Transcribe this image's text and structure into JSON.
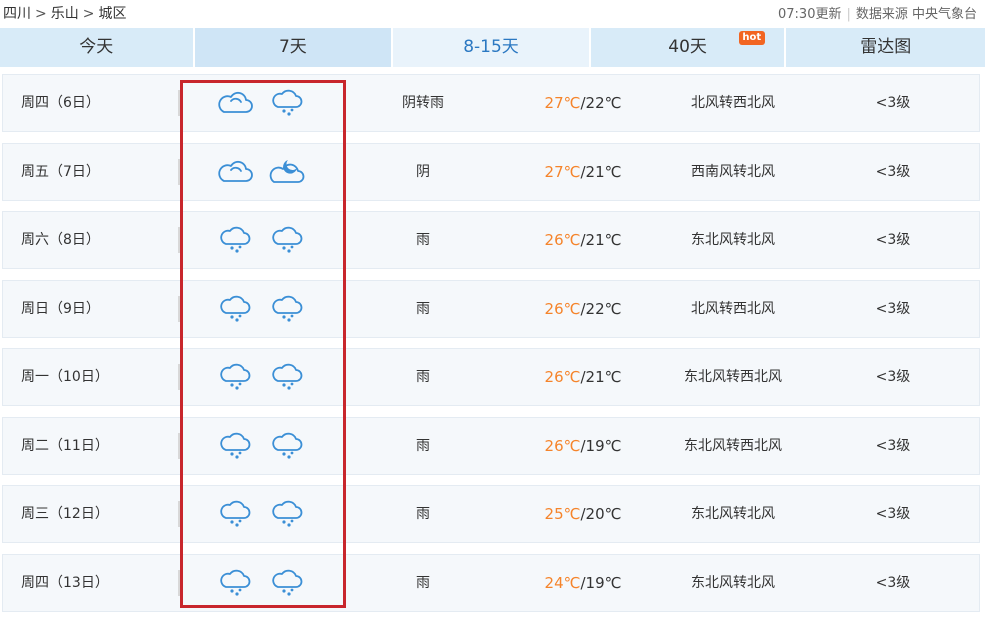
{
  "breadcrumb": {
    "province": "四川",
    "city": "乐山",
    "district": "城区",
    "sep": ">"
  },
  "meta": {
    "updated": "07:30更新",
    "source": "数据来源 中央气象台"
  },
  "tabs": [
    {
      "label": "今天"
    },
    {
      "label": "7天"
    },
    {
      "label": "8-15天"
    },
    {
      "label": "40天"
    },
    {
      "label": "雷达图"
    }
  ],
  "hot_badge": "hot",
  "forecast": [
    {
      "day": "周四（6日）",
      "icon_day": "cloudy-icon",
      "icon_night": "rain-icon",
      "desc": "阴转雨",
      "high": "27℃",
      "low": "/22℃",
      "wind": "北风转西北风",
      "level": "<3级"
    },
    {
      "day": "周五（7日）",
      "icon_day": "cloudy-icon",
      "icon_night": "cloudy-night-icon",
      "desc": "阴",
      "high": "27℃",
      "low": "/21℃",
      "wind": "西南风转北风",
      "level": "<3级"
    },
    {
      "day": "周六（8日）",
      "icon_day": "rain-icon",
      "icon_night": "rain-icon",
      "desc": "雨",
      "high": "26℃",
      "low": "/21℃",
      "wind": "东北风转北风",
      "level": "<3级"
    },
    {
      "day": "周日（9日）",
      "icon_day": "rain-icon",
      "icon_night": "rain-icon",
      "desc": "雨",
      "high": "26℃",
      "low": "/22℃",
      "wind": "北风转西北风",
      "level": "<3级"
    },
    {
      "day": "周一（10日）",
      "icon_day": "rain-icon",
      "icon_night": "rain-icon",
      "desc": "雨",
      "high": "26℃",
      "low": "/21℃",
      "wind": "东北风转西北风",
      "level": "<3级"
    },
    {
      "day": "周二（11日）",
      "icon_day": "rain-icon",
      "icon_night": "rain-icon",
      "desc": "雨",
      "high": "26℃",
      "low": "/19℃",
      "wind": "东北风转西北风",
      "level": "<3级"
    },
    {
      "day": "周三（12日）",
      "icon_day": "rain-icon",
      "icon_night": "rain-icon",
      "desc": "雨",
      "high": "25℃",
      "low": "/20℃",
      "wind": "东北风转北风",
      "level": "<3级"
    },
    {
      "day": "周四（13日）",
      "icon_day": "rain-icon",
      "icon_night": "rain-icon",
      "desc": "雨",
      "high": "24℃",
      "low": "/19℃",
      "wind": "东北风转北风",
      "level": "<3级"
    }
  ],
  "colors": {
    "accent": "#3b8fd6",
    "high_temp": "#f5842b",
    "highlight_box": "#c8262c"
  }
}
